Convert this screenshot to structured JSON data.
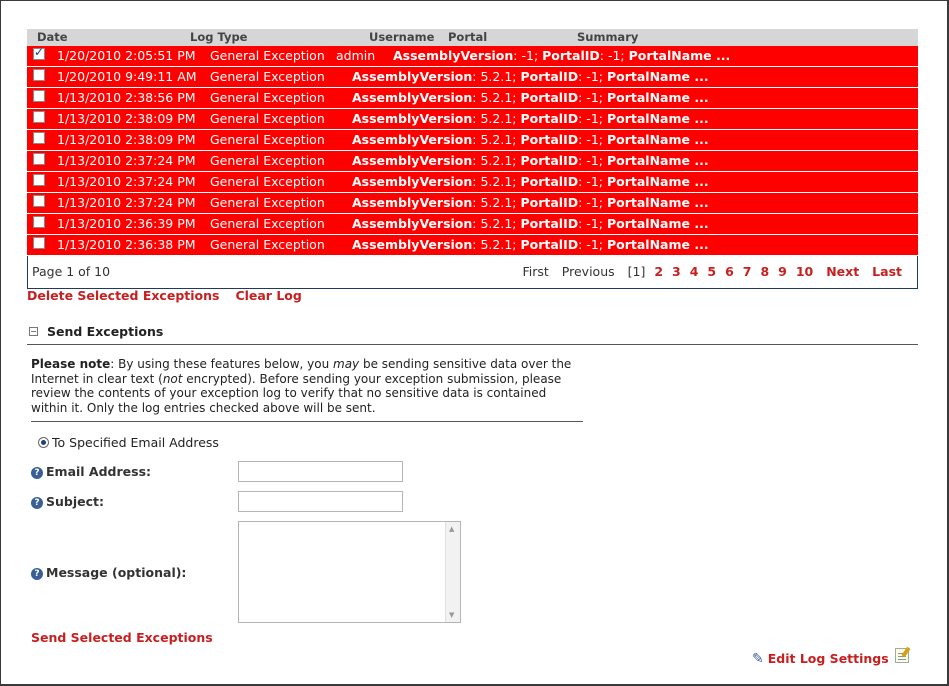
{
  "table": {
    "headers": {
      "date": "Date",
      "log_type": "Log Type",
      "username": "Username",
      "portal": "Portal",
      "summary": "Summary"
    },
    "rows": [
      {
        "checked": true,
        "date": "1/20/2010 2:05:51 PM",
        "type": "General Exception",
        "user": "admin",
        "s1": "AssemblyVersion",
        "s2": ": -1; ",
        "s3": "PortalID",
        "s4": ": -1; ",
        "s5": "PortalName ..."
      },
      {
        "checked": false,
        "date": "1/20/2010 9:49:11 AM",
        "type": "General Exception",
        "user": "",
        "s1": "AssemblyVersion",
        "s2": ": 5.2.1; ",
        "s3": "PortalID",
        "s4": ": -1; ",
        "s5": "PortalName ..."
      },
      {
        "checked": false,
        "date": "1/13/2010 2:38:56 PM",
        "type": "General Exception",
        "user": "",
        "s1": "AssemblyVersion",
        "s2": ": 5.2.1; ",
        "s3": "PortalID",
        "s4": ": -1; ",
        "s5": "PortalName ..."
      },
      {
        "checked": false,
        "date": "1/13/2010 2:38:09 PM",
        "type": "General Exception",
        "user": "",
        "s1": "AssemblyVersion",
        "s2": ": 5.2.1; ",
        "s3": "PortalID",
        "s4": ": -1; ",
        "s5": "PortalName ..."
      },
      {
        "checked": false,
        "date": "1/13/2010 2:38:09 PM",
        "type": "General Exception",
        "user": "",
        "s1": "AssemblyVersion",
        "s2": ": 5.2.1; ",
        "s3": "PortalID",
        "s4": ": -1; ",
        "s5": "PortalName ..."
      },
      {
        "checked": false,
        "date": "1/13/2010 2:37:24 PM",
        "type": "General Exception",
        "user": "",
        "s1": "AssemblyVersion",
        "s2": ": 5.2.1; ",
        "s3": "PortalID",
        "s4": ": -1; ",
        "s5": "PortalName ..."
      },
      {
        "checked": false,
        "date": "1/13/2010 2:37:24 PM",
        "type": "General Exception",
        "user": "",
        "s1": "AssemblyVersion",
        "s2": ": 5.2.1; ",
        "s3": "PortalID",
        "s4": ": -1; ",
        "s5": "PortalName ..."
      },
      {
        "checked": false,
        "date": "1/13/2010 2:37:24 PM",
        "type": "General Exception",
        "user": "",
        "s1": "AssemblyVersion",
        "s2": ": 5.2.1; ",
        "s3": "PortalID",
        "s4": ": -1; ",
        "s5": "PortalName ..."
      },
      {
        "checked": false,
        "date": "1/13/2010 2:36:39 PM",
        "type": "General Exception",
        "user": "",
        "s1": "AssemblyVersion",
        "s2": ": 5.2.1; ",
        "s3": "PortalID",
        "s4": ": -1; ",
        "s5": "PortalName ..."
      },
      {
        "checked": false,
        "date": "1/13/2010 2:36:38 PM",
        "type": "General Exception",
        "user": "",
        "s1": "AssemblyVersion",
        "s2": ": 5.2.1; ",
        "s3": "PortalID",
        "s4": ": -1; ",
        "s5": "PortalName ..."
      }
    ],
    "row_color": "#ff0000"
  },
  "pager": {
    "info": "Page 1 of 10",
    "first": "First",
    "previous": "Previous",
    "current": "[1]",
    "pages": [
      "2",
      "3",
      "4",
      "5",
      "6",
      "7",
      "8",
      "9",
      "10"
    ],
    "next": "Next",
    "last": "Last"
  },
  "actions": {
    "delete_selected": "Delete Selected Exceptions",
    "clear_log": "Clear Log"
  },
  "send_section": {
    "collapse_symbol": "⊟",
    "title": "Send Exceptions",
    "note_bold": "Please note",
    "note_1": ": By using these features below, you ",
    "note_may": "may",
    "note_2": " be sending sensitive data over the Internet in clear text (",
    "note_not": "not",
    "note_3": " encrypted). Before sending your exception submission, please review the contents of your exception log to verify that no sensitive data is contained within it. Only the log entries checked above will be sent.",
    "radio_label": "To Specified Email Address",
    "email_label": "Email Address:",
    "email_value": "",
    "subject_label": "Subject:",
    "subject_value": "",
    "message_label": "Message (optional):",
    "message_value": "",
    "help_symbol": "?",
    "send_button": "Send Selected Exceptions"
  },
  "footer": {
    "edit_settings": "Edit Log Settings",
    "pencil_icon": "pencil-icon",
    "notepad_icon": "notepad-icon"
  },
  "colors": {
    "link": "#c62020",
    "header_bg": "#d6d6d6",
    "accent": "#1d3f7a"
  }
}
